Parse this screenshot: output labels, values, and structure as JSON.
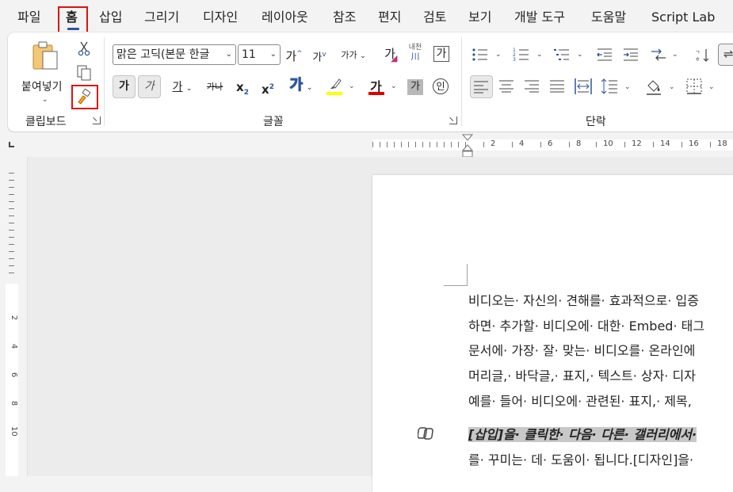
{
  "menu": {
    "tabs": [
      {
        "label": "파일"
      },
      {
        "label": "홈"
      },
      {
        "label": "삽입"
      },
      {
        "label": "그리기"
      },
      {
        "label": "디자인"
      },
      {
        "label": "레이아웃"
      },
      {
        "label": "참조"
      },
      {
        "label": "편지"
      },
      {
        "label": "검토"
      },
      {
        "label": "보기"
      },
      {
        "label": "개발 도구"
      },
      {
        "label": "도움말"
      },
      {
        "label": "Script Lab"
      }
    ],
    "active_tab": "홈"
  },
  "clipboard": {
    "group_label": "클립보드",
    "paste_label": "붙여넣기"
  },
  "font": {
    "group_label": "글꼴",
    "font_name": "맑은 고딕(본문 한글",
    "font_size": "11",
    "grow_label": "가",
    "shrink_label": "가",
    "case_label": "가가",
    "clear_label": "가",
    "phonetic_label": "내천",
    "phonetic_sub": "川",
    "border_label": "가",
    "bold_label": "가",
    "italic_label": "가",
    "underline_label": "가",
    "strike_label": "가나",
    "sub_label": "x",
    "sub_script": "2",
    "sup_label": "x",
    "sup_script": "2",
    "effects_label": "가",
    "color_label": "가",
    "shading_label": "가",
    "enclose_label": "인",
    "highlight_color": "#ffff00",
    "font_color": "#e00000"
  },
  "paragraph": {
    "group_label": "단락"
  },
  "ruler": {
    "numbers": [
      "2",
      "4",
      "6",
      "8",
      "10",
      "12",
      "14",
      "16",
      "18"
    ],
    "v_numbers": [
      "2",
      "4",
      "6",
      "8",
      "10"
    ]
  },
  "document": {
    "lines": [
      "비디오는· 자신의· 견해를· 효과적으로· 입증",
      "하면· 추가할· 비디오에· 대한· Embed· 태그",
      "문서에· 가장· 잘· 맞는· 비디오를· 온라인에",
      "머리글,· 바닥글,· 표지,· 텍스트· 상자· 디자",
      "예를· 들어· 비디오에· 관련된· 표지,· 제목,"
    ],
    "highlighted_line": "[삽입]을· 클릭한· 다음· 다른· 갤러리에서·",
    "last_line": "를· 꾸미는· 데· 도움이· 됩니다.[디자인]을·"
  },
  "colors": {
    "accent": "#2b579a",
    "annotation_red": "#e01010"
  }
}
